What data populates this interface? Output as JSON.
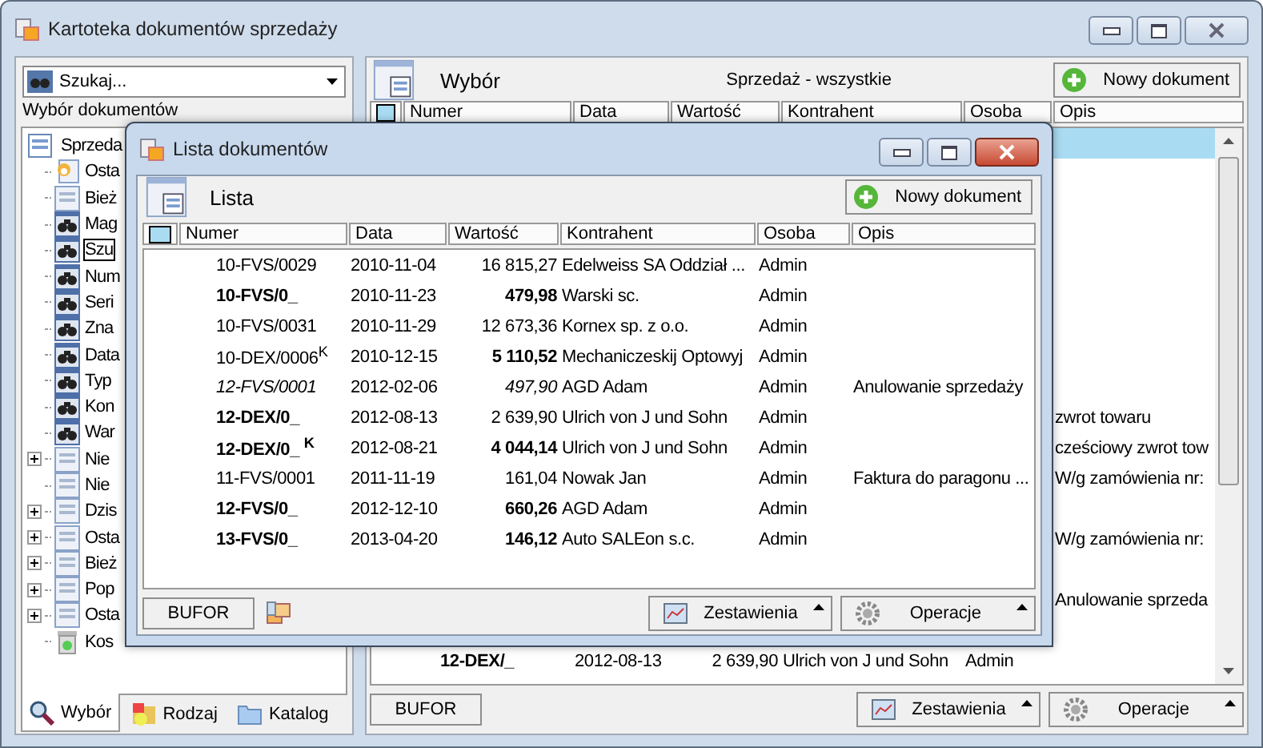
{
  "window": {
    "title": "Kartoteka dokumentów sprzedaży"
  },
  "left_panel": {
    "search": {
      "value": "Szukaj..."
    },
    "label": "Wybór dokumentów",
    "tree": [
      {
        "label": "Sprzeda",
        "kind": "list",
        "selected": false,
        "children": [
          {
            "label": "Osta",
            "kind": "recent",
            "selected": false
          },
          {
            "label": "Bież",
            "kind": "list",
            "selected": false
          },
          {
            "label": "Mag",
            "kind": "search",
            "selected": false
          },
          {
            "label": "Szu",
            "kind": "search",
            "selected": true
          },
          {
            "label": "Num",
            "kind": "search",
            "selected": false
          },
          {
            "label": "Seri",
            "kind": "search",
            "selected": false
          },
          {
            "label": "Zna",
            "kind": "search",
            "selected": false
          },
          {
            "label": "Data",
            "kind": "search",
            "selected": false
          },
          {
            "label": "Typ",
            "kind": "search",
            "selected": false
          },
          {
            "label": "Kon",
            "kind": "search",
            "selected": false
          },
          {
            "label": "War",
            "kind": "search",
            "selected": false
          },
          {
            "label": "Nie",
            "kind": "list",
            "selected": false,
            "expanded": false
          },
          {
            "label": "Nie",
            "kind": "list",
            "selected": false
          },
          {
            "label": "Dzis",
            "kind": "list",
            "selected": false,
            "expanded": false
          },
          {
            "label": "Osta",
            "kind": "list",
            "selected": false,
            "expanded": false
          },
          {
            "label": "Bież",
            "kind": "list",
            "selected": false,
            "expanded": false
          },
          {
            "label": "Pop",
            "kind": "list",
            "selected": false,
            "expanded": false
          },
          {
            "label": "Osta",
            "kind": "list",
            "selected": false,
            "expanded": false
          },
          {
            "label": "Kos",
            "kind": "bin",
            "selected": false
          }
        ]
      }
    ],
    "tabs": [
      {
        "label": "Wybór",
        "kind": "search",
        "selected": true
      },
      {
        "label": "Rodzaj",
        "kind": "category",
        "selected": false
      },
      {
        "label": "Katalog",
        "kind": "folder",
        "selected": false
      }
    ]
  },
  "right_panel": {
    "heading": "Wybór",
    "subtitle": "Sprzedaż - wszystkie",
    "new_button": "Nowy dokument",
    "select_all_checked": false,
    "columns": [
      "Numer",
      "Data",
      "Wartość",
      "Kontrahent",
      "Osoba",
      "Opis"
    ],
    "rows": [
      {
        "selected": true
      },
      {
        "selected": false
      },
      {
        "selected": false
      },
      {
        "selected": false
      },
      {
        "selected": false
      },
      {
        "selected": false
      },
      {
        "selected": false
      },
      {
        "selected": false
      },
      {
        "selected": false
      },
      {
        "selected": false,
        "opis": "zwrot towaru"
      },
      {
        "selected": false,
        "opis": "cześciowy zwrot tow"
      },
      {
        "selected": false,
        "opis": "W/g zamówienia nr:"
      },
      {
        "selected": false
      },
      {
        "selected": false,
        "opis": "W/g zamówienia nr:"
      },
      {
        "selected": false
      },
      {
        "selected": false,
        "opis": "Anulowanie sprzeda"
      },
      {
        "selected": false
      },
      {
        "selected": false,
        "numer": "12-DEX/_",
        "data": "2012-08-13",
        "wartosc": "2 639,90",
        "kontrahent": "Ulrich von J und Sohn",
        "osoba": "Admin",
        "numer_bold": true,
        "value_bold": false
      }
    ],
    "bufor_button": "BUFOR",
    "reports_button": "Zestawienia",
    "operations_button": "Operacje"
  },
  "dialog": {
    "title": "Lista dokumentów",
    "heading": "Lista",
    "new_button": "Nowy dokument",
    "select_all_checked": false,
    "columns": [
      "Numer",
      "Data",
      "Wartość",
      "Kontrahent",
      "Osoba",
      "Opis"
    ],
    "rows": [
      {
        "numer": "10-FVS/0029",
        "data": "2010-11-04",
        "wartosc": "16 815,27",
        "kontrahent": "Edelweiss SA Oddział ...",
        "osoba": "Admin",
        "numer_bold": false,
        "value_bold": false,
        "italic": false
      },
      {
        "numer": "10-FVS/0_",
        "data": "2010-11-23",
        "wartosc": "479,98",
        "kontrahent": "Warski sc.",
        "osoba": "Admin",
        "numer_bold": true,
        "value_bold": true,
        "italic": false
      },
      {
        "numer": "10-FVS/0031",
        "data": "2010-11-29",
        "wartosc": "12 673,36",
        "kontrahent": "Kornex sp. z o.o.",
        "osoba": "Admin",
        "numer_bold": false,
        "value_bold": false,
        "italic": false
      },
      {
        "numer": "10-DEX/0006$^{K}$",
        "data": "2010-12-15",
        "wartosc": "5 110,52",
        "kontrahent": "Mechaniczeskij Optowyj",
        "osoba": "Admin",
        "numer_bold": false,
        "value_bold": true,
        "italic": false
      },
      {
        "numer": "12-FVS/0001",
        "data": "2012-02-06",
        "wartosc": "497,90",
        "kontrahent": "AGD Adam",
        "osoba": "Admin",
        "opis": "Anulowanie sprzedaży",
        "numer_bold": false,
        "value_bold": false,
        "italic": true
      },
      {
        "numer": "12-DEX/0_",
        "data": "2012-08-13",
        "wartosc": "2 639,90",
        "kontrahent": "Ulrich von J und Sohn",
        "osoba": "Admin",
        "numer_bold": true,
        "value_bold": false,
        "italic": false
      },
      {
        "numer": "12-DEX/0_ $^{K}$",
        "data": "2012-08-21",
        "wartosc": "4 044,14",
        "kontrahent": "Ulrich von J und Sohn",
        "osoba": "Admin",
        "numer_bold": true,
        "value_bold": true,
        "italic": false
      },
      {
        "numer": "11-FVS/0001",
        "data": "2011-11-19",
        "wartosc": "161,04",
        "kontrahent": "Nowak Jan",
        "osoba": "Admin",
        "opis": "Faktura do paragonu ...",
        "numer_bold": false,
        "value_bold": false,
        "italic": false
      },
      {
        "numer": "12-FVS/0_",
        "data": "2012-12-10",
        "wartosc": "660,26",
        "kontrahent": "AGD Adam",
        "osoba": "Admin",
        "numer_bold": true,
        "value_bold": true,
        "italic": false
      },
      {
        "numer": "13-FVS/0_",
        "data": "2013-04-20",
        "wartosc": "146,12",
        "kontrahent": "Auto SALEon s.c.",
        "osoba": "Admin",
        "numer_bold": true,
        "value_bold": true,
        "italic": false
      }
    ],
    "bufor_button": "BUFOR",
    "reports_button": "Zestawienia",
    "operations_button": "Operacje"
  }
}
